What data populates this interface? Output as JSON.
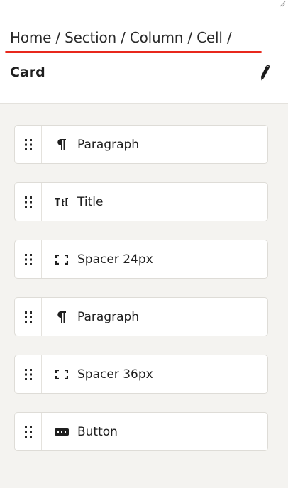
{
  "breadcrumb": {
    "text": "Home / Section / Column / Cell /",
    "current": "Card"
  },
  "edit_icon": "pencil-icon",
  "colors": {
    "accent": "#e8281c",
    "panel_bg": "#f4f3f0",
    "header_bg": "#ffffff",
    "block_border": "#dedcd7"
  },
  "blocks": [
    {
      "label": "Paragraph",
      "icon": "paragraph-icon"
    },
    {
      "label": "Title",
      "icon": "title-icon"
    },
    {
      "label": "Spacer 24px",
      "icon": "spacer-icon"
    },
    {
      "label": "Paragraph",
      "icon": "paragraph-icon"
    },
    {
      "label": "Spacer 36px",
      "icon": "spacer-icon"
    },
    {
      "label": "Button",
      "icon": "button-icon"
    }
  ]
}
